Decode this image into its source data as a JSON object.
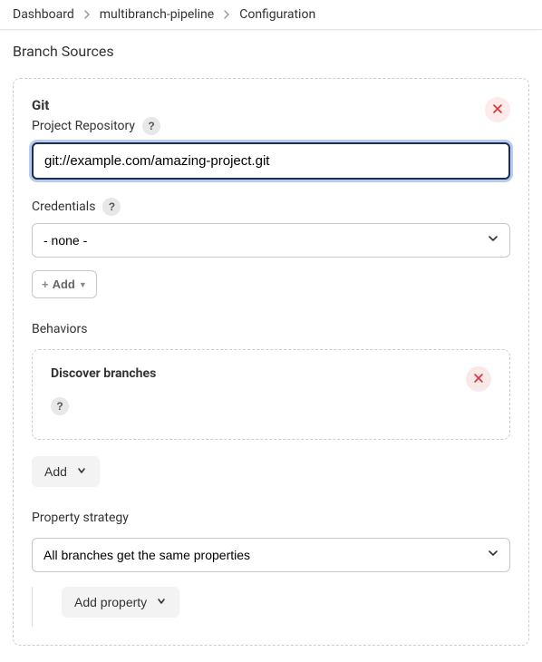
{
  "breadcrumb": {
    "items": [
      "Dashboard",
      "multibranch-pipeline",
      "Configuration"
    ]
  },
  "section": {
    "title": "Branch Sources"
  },
  "git_source": {
    "title": "Git",
    "repo_label": "Project Repository",
    "repo_value": "git://example.com/amazing-project.git",
    "credentials_label": "Credentials",
    "credentials_value": "- none -",
    "add_label": "Add"
  },
  "behaviors": {
    "heading": "Behaviors",
    "item_title": "Discover branches",
    "add_label": "Add"
  },
  "property_strategy": {
    "label": "Property strategy",
    "value": "All branches get the same properties",
    "add_property_label": "Add property"
  },
  "glyphs": {
    "help": "?"
  }
}
